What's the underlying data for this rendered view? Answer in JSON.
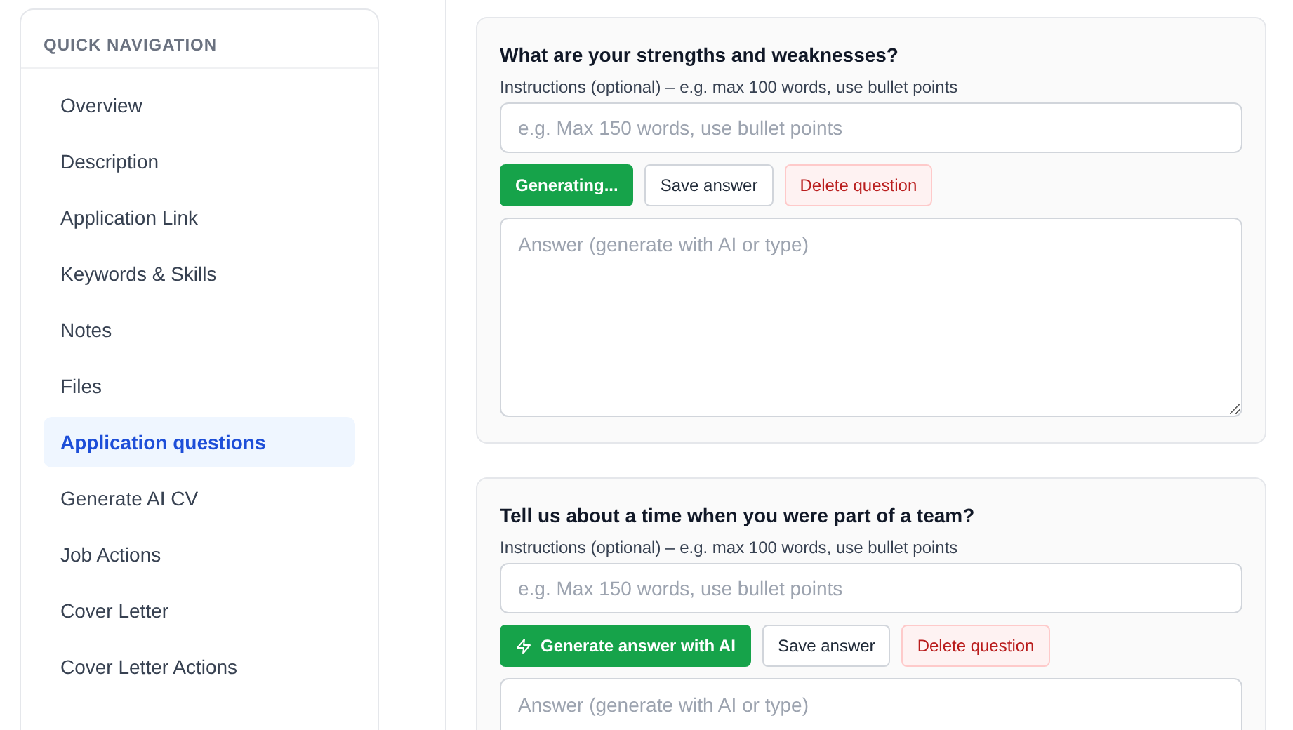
{
  "sidebar": {
    "title": "QUICK NAVIGATION",
    "items": [
      {
        "label": "Overview",
        "selected": false
      },
      {
        "label": "Description",
        "selected": false
      },
      {
        "label": "Application Link",
        "selected": false
      },
      {
        "label": "Keywords & Skills",
        "selected": false
      },
      {
        "label": "Notes",
        "selected": false
      },
      {
        "label": "Files",
        "selected": false
      },
      {
        "label": "Application questions",
        "selected": true
      },
      {
        "label": "Generate AI CV",
        "selected": false
      },
      {
        "label": "Job Actions",
        "selected": false
      },
      {
        "label": "Cover Letter",
        "selected": false
      },
      {
        "label": "Cover Letter Actions",
        "selected": false
      }
    ]
  },
  "questions": [
    {
      "question": "What are your strengths and weaknesses?",
      "instructions_label": "Instructions (optional) – e.g. max 100 words, use bullet points",
      "instructions": {
        "placeholder": "e.g. Max 150 words, use bullet points"
      },
      "generating": true,
      "generate_button": "Generating...",
      "save_button": "Save answer",
      "delete_button": "Delete question",
      "answer": {
        "placeholder": "Answer (generate with AI or type)"
      }
    },
    {
      "question": "Tell us about a time when you were part of a team?",
      "instructions_label": "Instructions (optional) – e.g. max 100 words, use bullet points",
      "instructions": {
        "placeholder": "e.g. Max 150 words, use bullet points"
      },
      "generating": false,
      "generate_button": "Generate answer with AI",
      "save_button": "Save answer",
      "delete_button": "Delete question",
      "answer": {
        "placeholder": "Answer (generate with AI or type)"
      }
    }
  ]
}
